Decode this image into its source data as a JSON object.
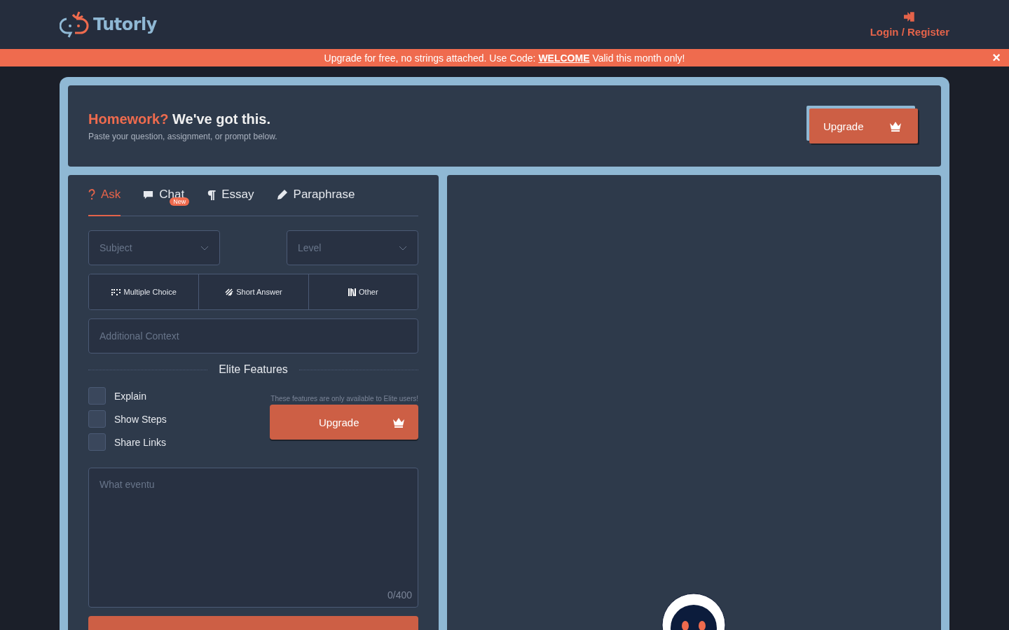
{
  "header": {
    "brand": "Tutorly",
    "login": "Login / Register"
  },
  "banner": {
    "text": "Upgrade for free, no strings attached. Use Code: **WELCOME** Valid this month only!",
    "close": "×"
  },
  "hero": {
    "title_accent": "Homework?",
    "title": "We've got this.",
    "subtitle": "Paste your question, assignment, or prompt below.",
    "upgrade": "Upgrade"
  },
  "tabs": [
    {
      "label": "Ask",
      "selected": true
    },
    {
      "label": "Chat",
      "selected": false,
      "badge": "New"
    },
    {
      "label": "Essay",
      "selected": false
    },
    {
      "label": "Paraphrase",
      "selected": false
    }
  ],
  "subject": {
    "placeholder": "Subject"
  },
  "level": {
    "placeholder": "Level"
  },
  "question_types": [
    {
      "label": "Multiple Choice",
      "selected": false
    },
    {
      "label": "Short Answer",
      "selected": false
    },
    {
      "label": "Other",
      "selected": false
    }
  ],
  "context": {
    "placeholder": "Additional Context"
  },
  "elite": {
    "heading": "Elite Features",
    "note": "These features are only available to Elite users!",
    "upgrade": "Upgrade",
    "options": [
      {
        "label": "Explain",
        "checked": false
      },
      {
        "label": "Show Steps",
        "checked": false
      },
      {
        "label": "Share Links",
        "checked": false
      }
    ]
  },
  "question": {
    "placeholder": "What eventu",
    "counter": "0/400"
  }
}
